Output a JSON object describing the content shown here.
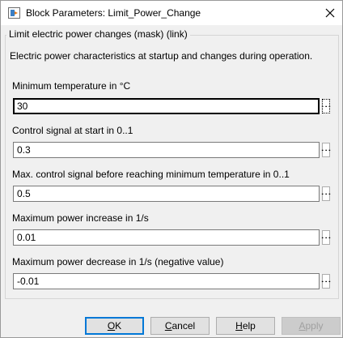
{
  "window": {
    "title": "Block Parameters: Limit_Power_Change"
  },
  "group": {
    "title": "Limit electric power changes (mask) (link)",
    "description": "Electric power characteristics at startup and changes during operation."
  },
  "parameters": [
    {
      "label": "Minimum temperature in °C",
      "value": "30"
    },
    {
      "label": "Control signal at start in 0..1",
      "value": "0.3"
    },
    {
      "label": "Max. control signal before reaching minimum temperature in 0..1",
      "value": "0.5"
    },
    {
      "label": "Maximum power increase in 1/s",
      "value": "0.01"
    },
    {
      "label": "Maximum power decrease in 1/s (negative value)",
      "value": "-0.01"
    }
  ],
  "buttons": {
    "ok": {
      "mnemonic": "O",
      "rest": "K"
    },
    "cancel": {
      "mnemonic": "C",
      "rest": "ancel"
    },
    "help": {
      "mnemonic": "H",
      "rest": "elp"
    },
    "apply": {
      "mnemonic": "A",
      "rest": "pply"
    }
  },
  "icons": {
    "app": "simulink-block-icon",
    "close": "close-icon",
    "param_menu": "vertical-ellipsis-icon"
  }
}
